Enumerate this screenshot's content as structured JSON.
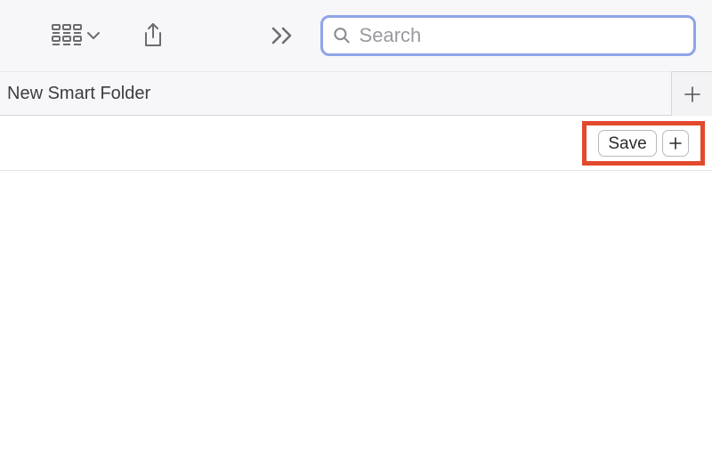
{
  "toolbar": {
    "view_options_icon": "grid-view-icon",
    "share_icon": "share-icon",
    "overflow_icon": "chevrons-right-icon",
    "search_placeholder": "Search"
  },
  "header": {
    "title": "New Smart Folder",
    "add_tab_label": "+"
  },
  "criteria": {
    "save_label": "Save",
    "add_rule_label": "+"
  },
  "highlight": {
    "color": "#e24a2d"
  }
}
